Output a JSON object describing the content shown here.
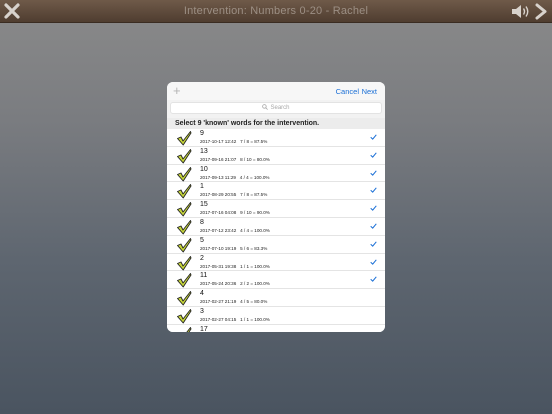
{
  "app": {
    "title": "Intervention: Numbers 0-20 - Rachel"
  },
  "modal": {
    "plus_label": "+",
    "cancel_label": "Cancel",
    "next_label": "Next",
    "search_placeholder": "Search",
    "instruction": "Select 9 'known' words for the intervention."
  },
  "colors": {
    "accent": "#1a6fd6",
    "check_fill": "#c7d63a",
    "topbar": "#5e4a3b"
  },
  "rows": [
    {
      "word": "9",
      "stats": "2017-10-17 12:42   7 / 8 = 87.5%",
      "selected": true
    },
    {
      "word": "13",
      "stats": "2017-09-16 21:07   8 / 10 = 80.0%",
      "selected": true
    },
    {
      "word": "10",
      "stats": "2017-09-13 11:29   4 / 4 = 100.0%",
      "selected": true
    },
    {
      "word": "1",
      "stats": "2017-08-29 20:55   7 / 8 = 87.5%",
      "selected": true
    },
    {
      "word": "15",
      "stats": "2017-07-16 04:08   9 / 10 = 90.0%",
      "selected": true
    },
    {
      "word": "8",
      "stats": "2017-07-12 23:42   4 / 4 = 100.0%",
      "selected": true
    },
    {
      "word": "5",
      "stats": "2017-07-10 19:19   5 / 6 = 83.3%",
      "selected": true
    },
    {
      "word": "2",
      "stats": "2017-05-31 19:38   1 / 1 = 100.0%",
      "selected": true
    },
    {
      "word": "11",
      "stats": "2017-05-24 20:36   2 / 2 = 100.0%",
      "selected": true
    },
    {
      "word": "4",
      "stats": "2017-02-27 21:19   4 / 5 = 80.0%",
      "selected": false
    },
    {
      "word": "3",
      "stats": "2017-02-27 04:15   1 / 1 = 100.0%",
      "selected": false
    },
    {
      "word": "17",
      "stats": "",
      "selected": false
    }
  ]
}
